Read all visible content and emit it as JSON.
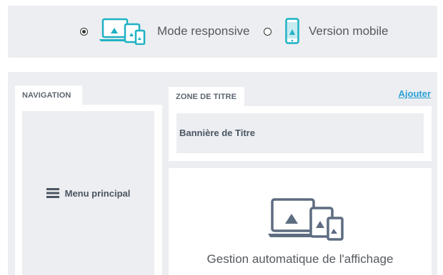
{
  "display_mode": {
    "options": [
      {
        "label": "Mode responsive",
        "selected": true,
        "icon": "responsive-devices-icon"
      },
      {
        "label": "Version mobile",
        "selected": false,
        "icon": "mobile-phone-icon"
      }
    ]
  },
  "navigation": {
    "tab_label": "NAVIGATION",
    "menu_label": "Menu principal",
    "menu_icon": "hamburger-icon"
  },
  "title_zone": {
    "tab_label": "ZONE DE TITRE",
    "add_label": "Ajouter",
    "banner_label": "Bannière de Titre"
  },
  "content_zone": {
    "caption": "Gestion automatique de l'affichage",
    "icon": "responsive-devices-icon"
  },
  "colors": {
    "accent_teal": "#1fb1c4",
    "link_blue": "#2aa0d4",
    "icon_slate": "#5d6c80",
    "panel_gray": "#eceef1"
  }
}
